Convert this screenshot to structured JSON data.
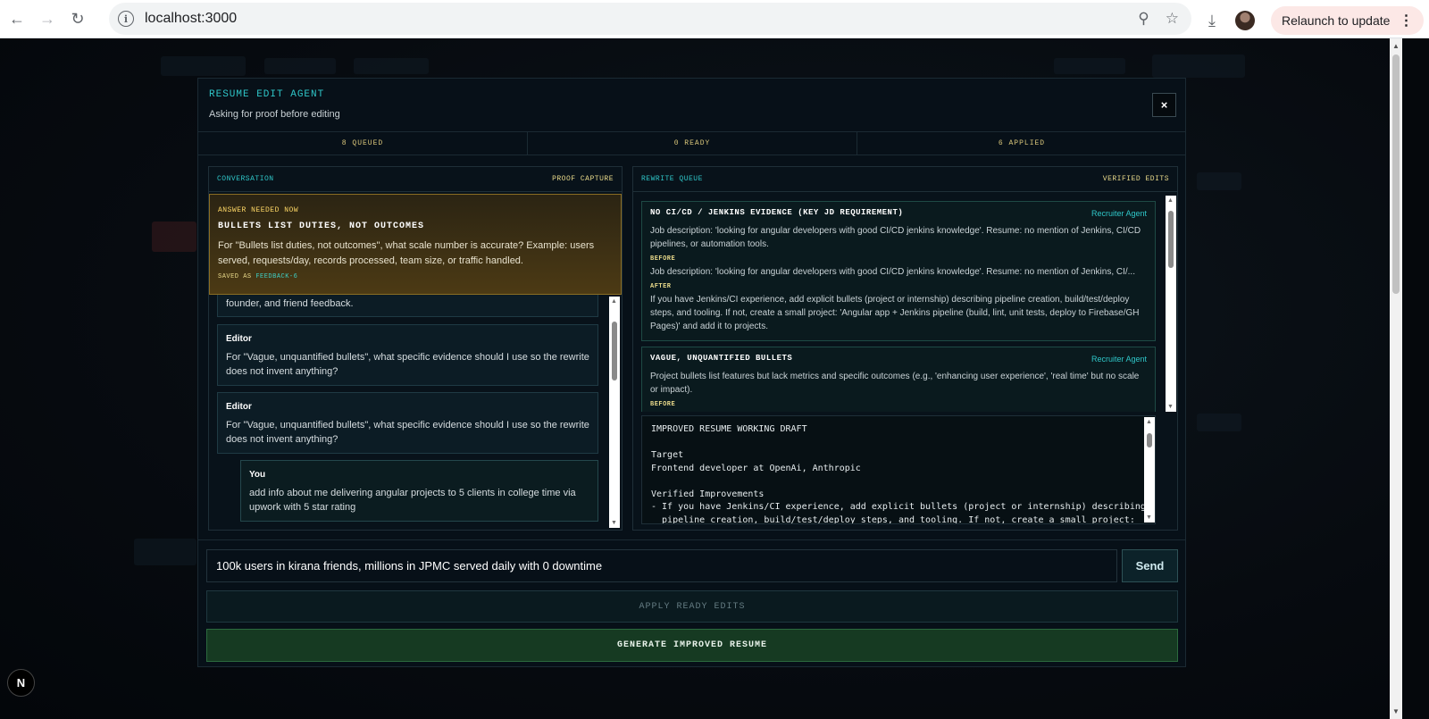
{
  "browser": {
    "url": "localhost:3000",
    "relaunch_label": "Relaunch to update"
  },
  "badge": {
    "label": "N"
  },
  "modal": {
    "title": "RESUME EDIT AGENT",
    "subtitle": "Asking for proof before editing",
    "close_label": "×",
    "stats": [
      "8 QUEUED",
      "0 READY",
      "6 APPLIED"
    ]
  },
  "conversation": {
    "header_left": "CONVERSATION",
    "header_right": "PROOF CAPTURE",
    "alert": {
      "label": "ANSWER NEEDED NOW",
      "title": "BULLETS LIST DUTIES, NOT OUTCOMES",
      "body": "For \"Bullets list duties, not outcomes\", what scale number is accurate? Example: users served, requests/day, records processed, team size, or traffic handled.",
      "saved_prefix": "SAVED AS",
      "saved_id": "FEEDBACK-6"
    },
    "partial_text": "founder, and friend feedback.",
    "messages": [
      {
        "who": "Editor",
        "text": "For \"Vague, unquantified bullets\", what specific evidence should I use so the rewrite does not invent anything?"
      },
      {
        "who": "Editor",
        "text": "For \"Vague, unquantified bullets\", what specific evidence should I use so the rewrite does not invent anything?"
      },
      {
        "who": "You",
        "text": "add info about me delivering angular projects to 5 clients in college time via upwork with 5 star rating"
      }
    ]
  },
  "queue": {
    "header_left": "REWRITE QUEUE",
    "header_right": "VERIFIED EDITS",
    "cards": [
      {
        "title": "NO CI/CD / JENKINS EVIDENCE (KEY JD REQUIREMENT)",
        "agent": "Recruiter Agent",
        "text": "Job description: 'looking for angular developers with good CI/CD jenkins knowledge'. Resume: no mention of Jenkins, CI/CD pipelines, or automation tools.",
        "before_label": "BEFORE",
        "before": "Job description: 'looking for angular developers with good CI/CD jenkins knowledge'. Resume: no mention of Jenkins, CI/...",
        "after_label": "AFTER",
        "after": "If you have Jenkins/CI experience, add explicit bullets (project or internship) describing pipeline creation, build/test/deploy steps, and tooling. If not, create a small project: 'Angular app + Jenkins pipeline (build, lint, unit tests, deploy to Firebase/GH Pages)' and add it to projects."
      },
      {
        "title": "VAGUE, UNQUANTIFIED BULLETS",
        "agent": "Recruiter Agent",
        "text": "Project bullets list features but lack metrics and specific outcomes (e.g., 'enhancing user experience', 'real time' but no scale or impact).",
        "before_label": "BEFORE"
      }
    ],
    "draft": "IMPROVED RESUME WORKING DRAFT\n\nTarget\nFrontend developer at OpenAi, Anthropic\n\nVerified Improvements\n- If you have Jenkins/CI experience, add explicit bullets (project or internship) describing\n  pipeline creation, build/test/deploy steps, and tooling. If not, create a small project:"
  },
  "composer": {
    "input_value": "100k users in kirana friends, millions in JPMC served daily with 0 downtime",
    "send_label": "Send",
    "apply_label": "APPLY READY EDITS",
    "generate_label": "GENERATE IMPROVED RESUME"
  }
}
